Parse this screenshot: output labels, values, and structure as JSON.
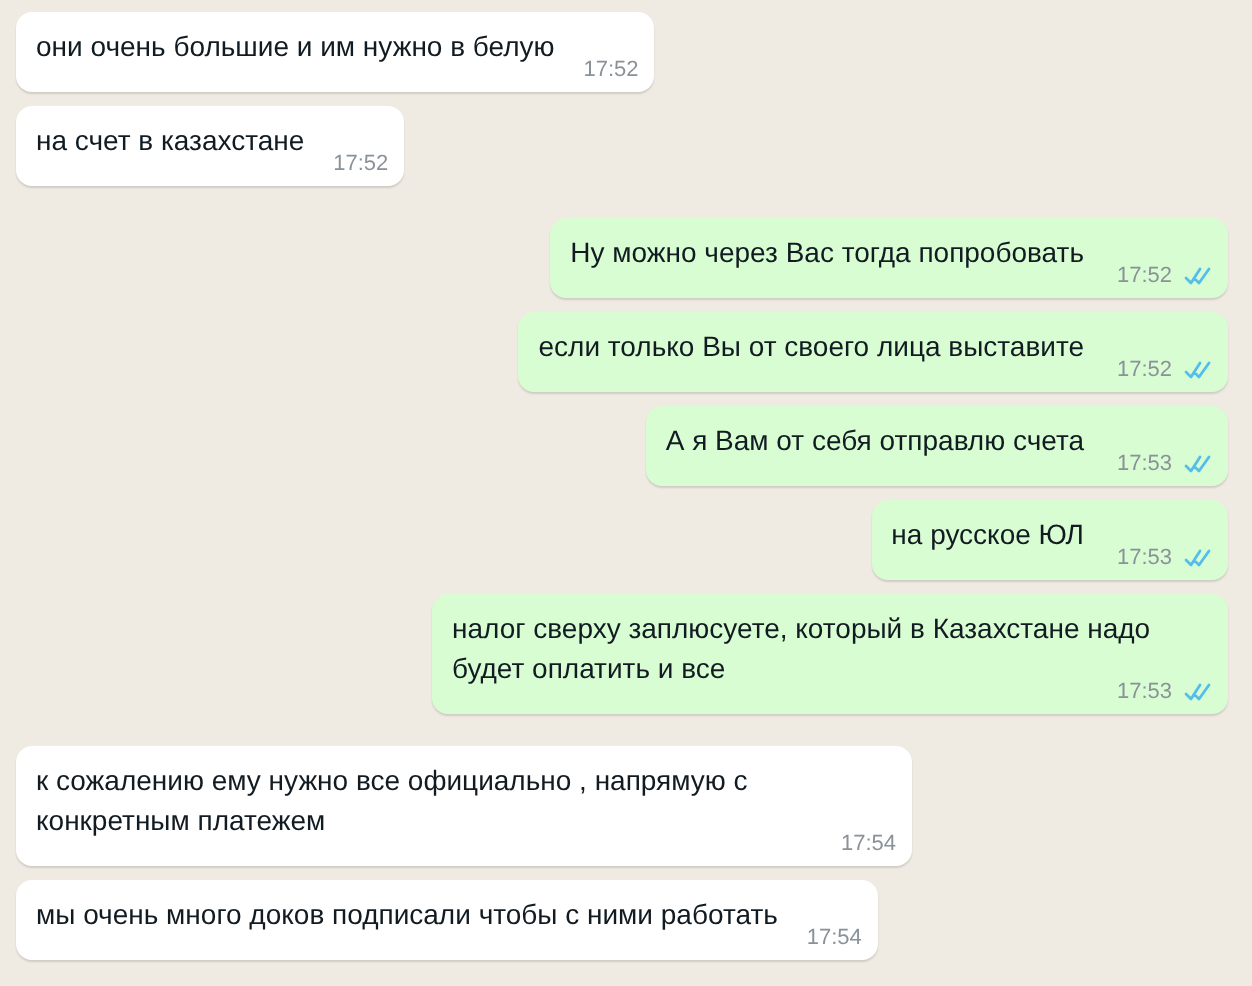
{
  "messages": [
    {
      "kind": "incoming",
      "text": "они очень большие и им нужно в белую",
      "time": "17:52"
    },
    {
      "kind": "incoming",
      "text": "на счет в казахстане",
      "time": "17:52"
    },
    {
      "kind": "outgoing",
      "text": "Ну можно через Вас тогда попробовать",
      "time": "17:52",
      "read": true
    },
    {
      "kind": "outgoing",
      "text": "если только Вы от своего лица выставите",
      "time": "17:52",
      "read": true
    },
    {
      "kind": "outgoing",
      "text": "А я Вам от себя отправлю счета",
      "time": "17:53",
      "read": true
    },
    {
      "kind": "outgoing",
      "text": "на русское ЮЛ",
      "time": "17:53",
      "read": true
    },
    {
      "kind": "outgoing",
      "text": "налог сверху заплюсуете, который в Казахстане надо будет оплатить и все",
      "time": "17:53",
      "read": true
    },
    {
      "kind": "incoming",
      "text": "к сожалению ему нужно все официально , напрямую с конкретным платежем",
      "time": "17:54"
    },
    {
      "kind": "incoming",
      "text": "мы очень много доков подписали чтобы с ними работать",
      "time": "17:54"
    }
  ]
}
